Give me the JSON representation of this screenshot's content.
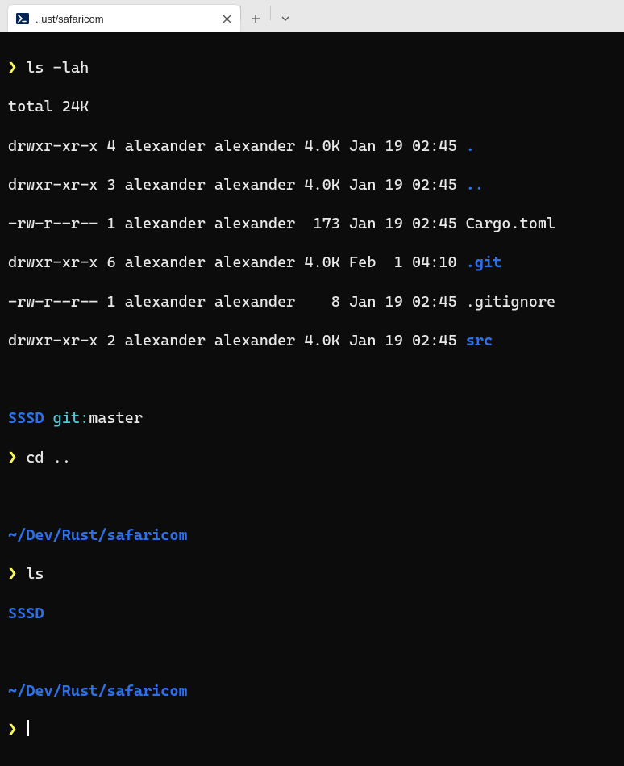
{
  "tab": {
    "title": "..ust/safaricom"
  },
  "titlebar": {
    "new_tab": "+",
    "dropdown": "⌄"
  },
  "term": {
    "p1": "❯",
    "cmd1": "ls -lah",
    "total": "total 24K",
    "l1a": "drwxr-xr-x 4 alexander alexander 4.0K Jan 19 02:45 ",
    "l1b": ".",
    "l2a": "drwxr-xr-x 3 alexander alexander 4.0K Jan 19 02:45 ",
    "l2b": "..",
    "l3": "-rw-r--r-- 1 alexander alexander  173 Jan 19 02:45 Cargo.toml",
    "l4a": "drwxr-xr-x 6 alexander alexander 4.0K Feb  1 04:10 ",
    "l4b": ".git",
    "l5": "-rw-r--r-- 1 alexander alexander    8 Jan 19 02:45 .gitignore",
    "l6a": "drwxr-xr-x 2 alexander alexander 4.0K Jan 19 02:45 ",
    "l6b": "src",
    "ps1_dir": "SSSD",
    "ps1_git": "git:",
    "ps1_branch": "master",
    "cmd2": "cd ..",
    "path2": "~/Dev/Rust/safaricom",
    "cmd3": "ls",
    "out3": "SSSD",
    "path3": "~/Dev/Rust/safaricom"
  }
}
